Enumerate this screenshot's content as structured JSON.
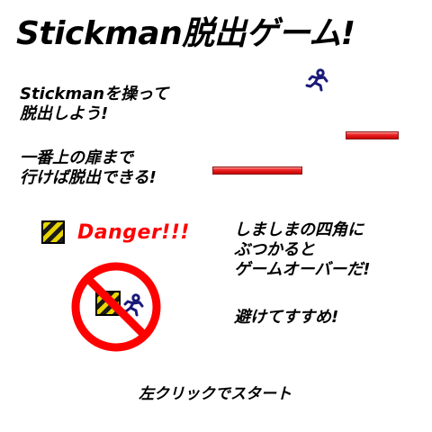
{
  "title": "Stickman脱出ゲーム!",
  "instructions": {
    "control": [
      "Stickmanを操って",
      "脱出しよう!"
    ],
    "goal": [
      "一番上の扉まで",
      "行けば脱出できる!"
    ],
    "hazard": [
      "しましまの四角に",
      "ぶつかると",
      "ゲームオーバーだ!"
    ],
    "advance": [
      "避けてすすめ!"
    ]
  },
  "danger": {
    "label": "Danger!!!",
    "icon": "hazard-stripe-icon"
  },
  "forbidden_sign": {
    "icon": "no-touch-icon"
  },
  "start_hint": "左クリックでスタート",
  "colors": {
    "background": "#ffffff",
    "text": "#000000",
    "danger_text": "#ff0000",
    "platform": "#e01e1e",
    "stickman": "#1a1a7a",
    "hazard_yellow": "#e8d500",
    "hazard_black": "#1a1a1a",
    "prohibit_red": "#ff0000"
  }
}
